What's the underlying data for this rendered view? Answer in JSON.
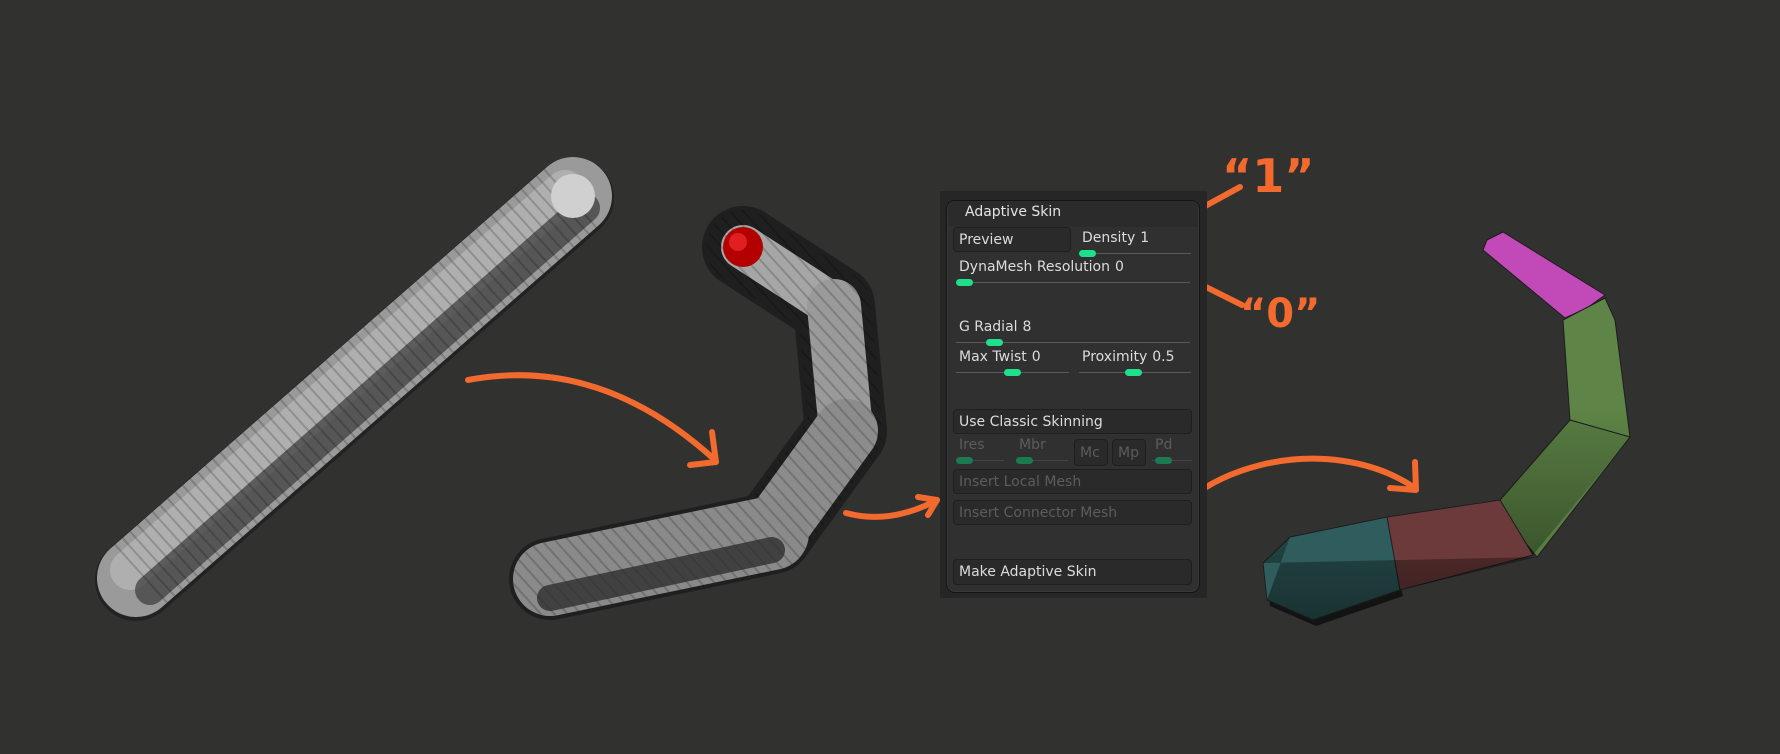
{
  "panel": {
    "title": "Adaptive Skin",
    "preview_label": "Preview",
    "density": {
      "label": "Density",
      "value": "1",
      "fraction": 0
    },
    "dynamesh": {
      "label": "DynaMesh Resolution",
      "value": "0",
      "fraction": 0
    },
    "g_radial": {
      "label": "G Radial",
      "value": "8",
      "fraction": 0.15
    },
    "max_twist": {
      "label": "Max Twist",
      "value": "0",
      "fraction": 0.45
    },
    "proximity": {
      "label": "Proximity",
      "value": "0.5",
      "fraction": 0.45
    },
    "use_classic_label": "Use Classic Skinning",
    "ires_label": "Ires",
    "mbr_label": "Mbr",
    "mc_label": "Mc",
    "mp_label": "Mp",
    "pd_label": "Pd",
    "insert_local_label": "Insert Local Mesh",
    "insert_connector_label": "Insert Connector Mesh",
    "make_skin_label": "Make Adaptive Skin"
  },
  "annotations": {
    "one": "“1”",
    "zero": "“0”"
  },
  "colors": {
    "accent": "#1ee08a",
    "annotation": "#f26a2e",
    "background": "#313130"
  }
}
